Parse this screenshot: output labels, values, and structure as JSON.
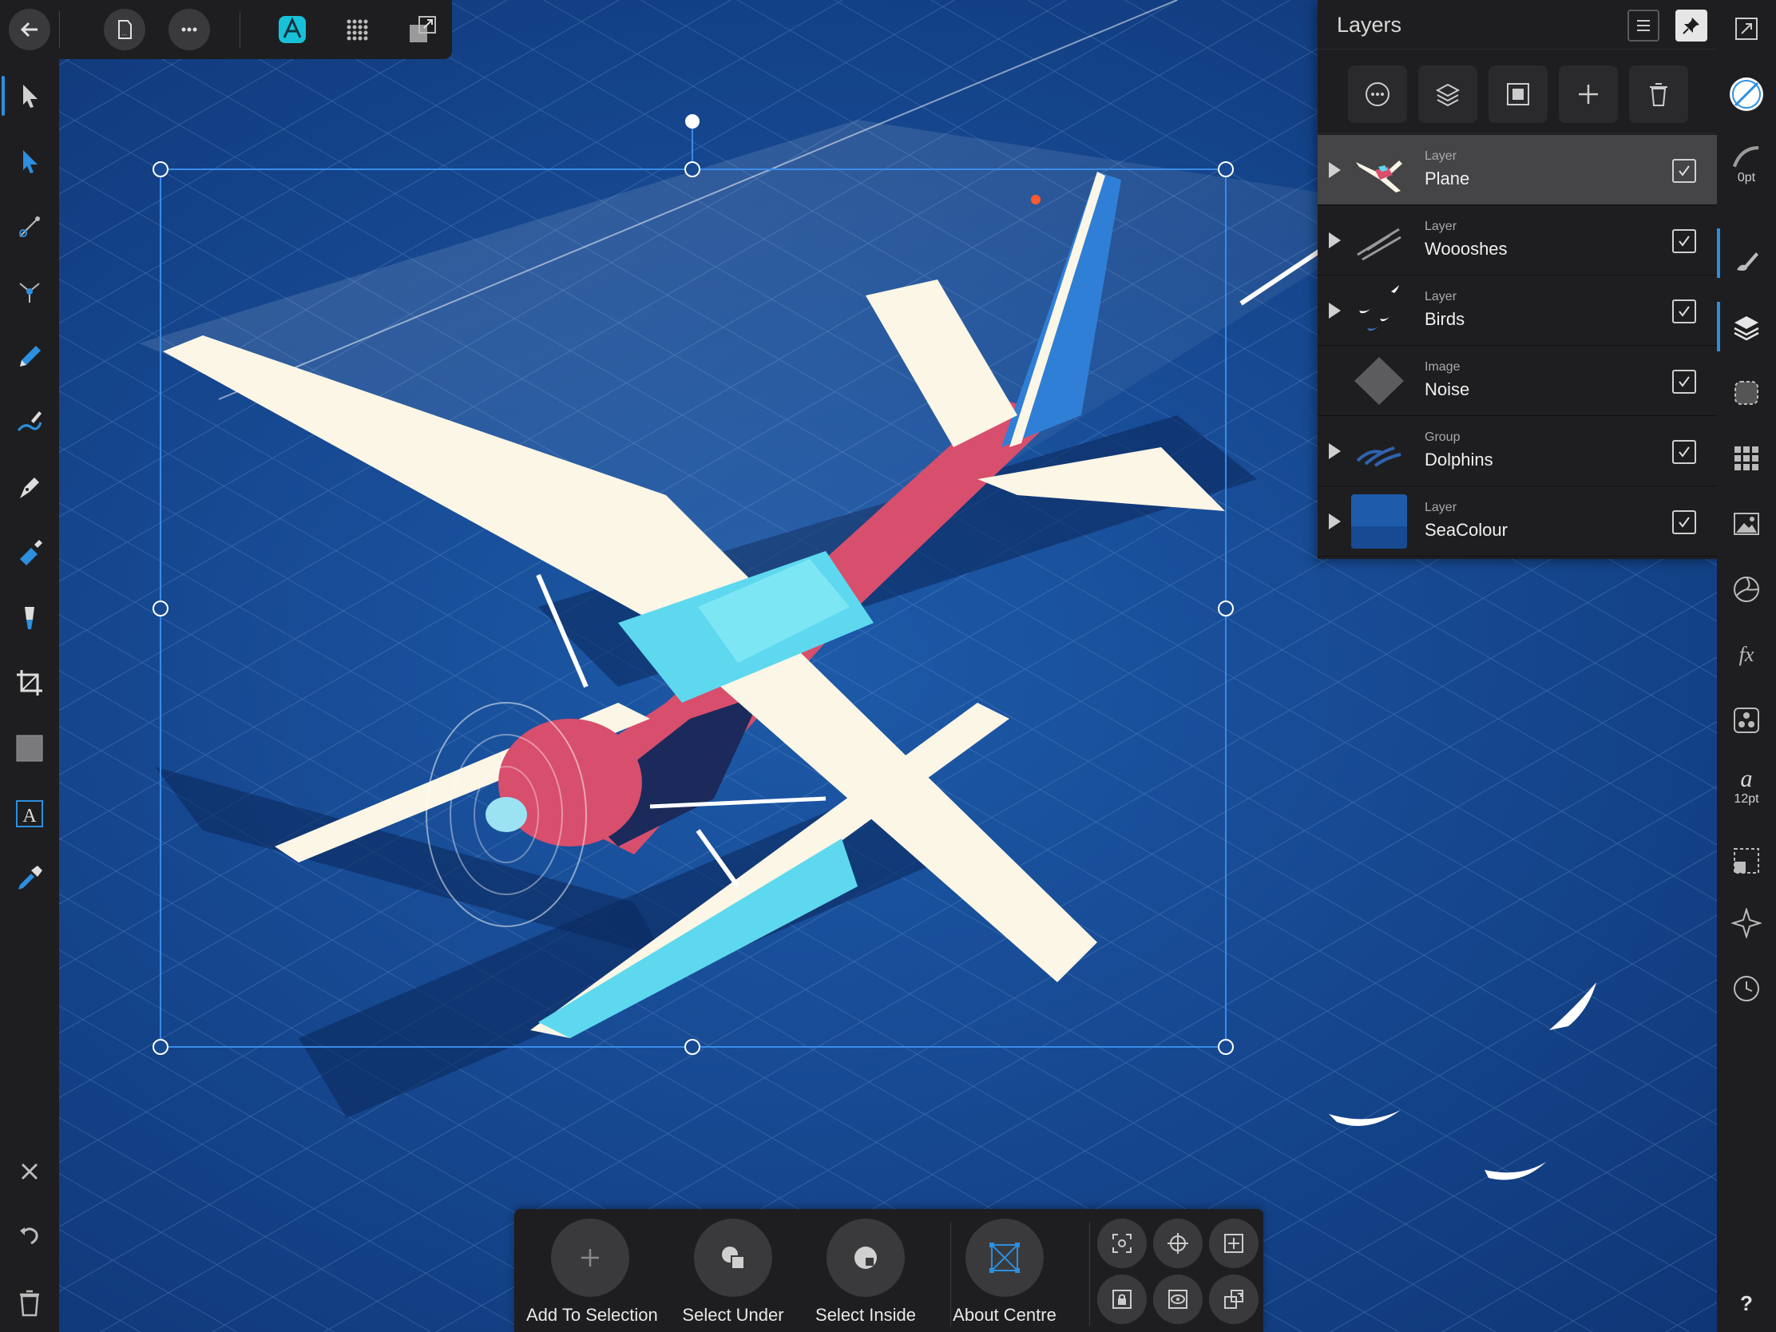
{
  "app": {
    "name": "Affinity Designer"
  },
  "top_bar": {
    "back_icon": "back-arrow-icon",
    "document_icon": "document-icon",
    "more_icon": "more-dots-icon",
    "persona_icon": "designer-persona-icon",
    "pixel_persona_icon": "pixel-persona-icon",
    "export_persona_icon": "export-persona-icon"
  },
  "layers_panel": {
    "title": "Layers",
    "layers": [
      {
        "type": "Layer",
        "name": "Plane",
        "selected": true,
        "has_children": true,
        "visible": true
      },
      {
        "type": "Layer",
        "name": "Woooshes",
        "selected": false,
        "has_children": true,
        "visible": true
      },
      {
        "type": "Layer",
        "name": "Birds",
        "selected": false,
        "has_children": true,
        "visible": true
      },
      {
        "type": "Image",
        "name": "Noise",
        "selected": false,
        "has_children": false,
        "visible": true
      },
      {
        "type": "Group",
        "name": "Dolphins",
        "selected": false,
        "has_children": true,
        "visible": true
      },
      {
        "type": "Layer",
        "name": "SeaColour",
        "selected": false,
        "has_children": true,
        "visible": true
      }
    ]
  },
  "right_toolbar": {
    "stroke_width": "0pt",
    "font_size": "12pt"
  },
  "context_bar": {
    "add_to_selection": "Add To Selection",
    "select_under": "Select Under",
    "select_inside": "Select Inside",
    "about_centre": "About Centre"
  },
  "colors": {
    "accent": "#2c8fe0",
    "canvas_blue": "#174a93",
    "panel_bg": "#1e1e20"
  }
}
